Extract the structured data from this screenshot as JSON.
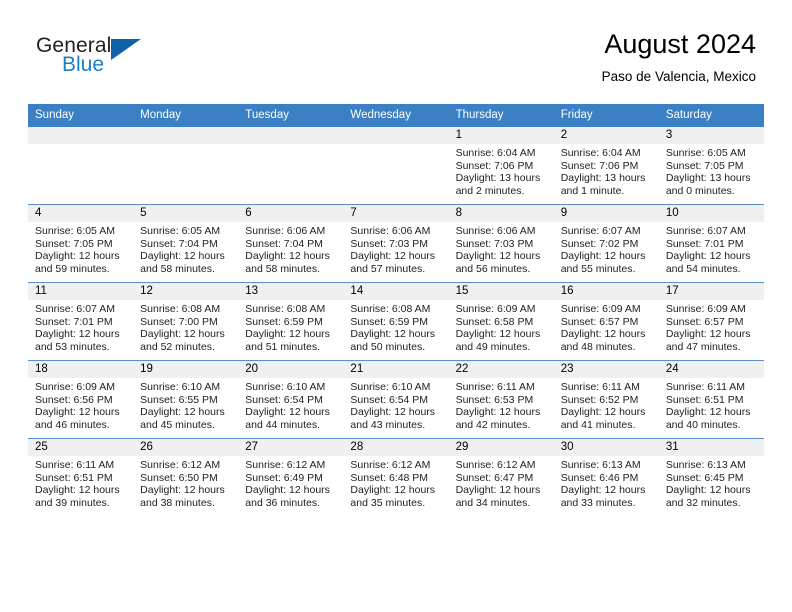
{
  "brand": {
    "word1": "General",
    "word2": "Blue",
    "triangle_color": "#0f62a8",
    "blue_text_color": "#1b7fc4"
  },
  "header": {
    "title": "August 2024",
    "subtitle": "Paso de Valencia, Mexico",
    "header_bg": "#3b7fc4",
    "daynum_bg": "#f0f0f0"
  },
  "weekday_headers": [
    "Sunday",
    "Monday",
    "Tuesday",
    "Wednesday",
    "Thursday",
    "Friday",
    "Saturday"
  ],
  "labels": {
    "sunrise": "Sunrise:",
    "sunset": "Sunset:",
    "daylight": "Daylight:"
  },
  "weeks": [
    [
      {
        "day": "",
        "empty": true
      },
      {
        "day": "",
        "empty": true
      },
      {
        "day": "",
        "empty": true
      },
      {
        "day": "",
        "empty": true
      },
      {
        "day": "1",
        "sunrise": "Sunrise: 6:04 AM",
        "sunset": "Sunset: 7:06 PM",
        "daylight_l1": "Daylight: 13 hours",
        "daylight_l2": "and 2 minutes."
      },
      {
        "day": "2",
        "sunrise": "Sunrise: 6:04 AM",
        "sunset": "Sunset: 7:06 PM",
        "daylight_l1": "Daylight: 13 hours",
        "daylight_l2": "and 1 minute."
      },
      {
        "day": "3",
        "sunrise": "Sunrise: 6:05 AM",
        "sunset": "Sunset: 7:05 PM",
        "daylight_l1": "Daylight: 13 hours",
        "daylight_l2": "and 0 minutes."
      }
    ],
    [
      {
        "day": "4",
        "sunrise": "Sunrise: 6:05 AM",
        "sunset": "Sunset: 7:05 PM",
        "daylight_l1": "Daylight: 12 hours",
        "daylight_l2": "and 59 minutes."
      },
      {
        "day": "5",
        "sunrise": "Sunrise: 6:05 AM",
        "sunset": "Sunset: 7:04 PM",
        "daylight_l1": "Daylight: 12 hours",
        "daylight_l2": "and 58 minutes."
      },
      {
        "day": "6",
        "sunrise": "Sunrise: 6:06 AM",
        "sunset": "Sunset: 7:04 PM",
        "daylight_l1": "Daylight: 12 hours",
        "daylight_l2": "and 58 minutes."
      },
      {
        "day": "7",
        "sunrise": "Sunrise: 6:06 AM",
        "sunset": "Sunset: 7:03 PM",
        "daylight_l1": "Daylight: 12 hours",
        "daylight_l2": "and 57 minutes."
      },
      {
        "day": "8",
        "sunrise": "Sunrise: 6:06 AM",
        "sunset": "Sunset: 7:03 PM",
        "daylight_l1": "Daylight: 12 hours",
        "daylight_l2": "and 56 minutes."
      },
      {
        "day": "9",
        "sunrise": "Sunrise: 6:07 AM",
        "sunset": "Sunset: 7:02 PM",
        "daylight_l1": "Daylight: 12 hours",
        "daylight_l2": "and 55 minutes."
      },
      {
        "day": "10",
        "sunrise": "Sunrise: 6:07 AM",
        "sunset": "Sunset: 7:01 PM",
        "daylight_l1": "Daylight: 12 hours",
        "daylight_l2": "and 54 minutes."
      }
    ],
    [
      {
        "day": "11",
        "sunrise": "Sunrise: 6:07 AM",
        "sunset": "Sunset: 7:01 PM",
        "daylight_l1": "Daylight: 12 hours",
        "daylight_l2": "and 53 minutes."
      },
      {
        "day": "12",
        "sunrise": "Sunrise: 6:08 AM",
        "sunset": "Sunset: 7:00 PM",
        "daylight_l1": "Daylight: 12 hours",
        "daylight_l2": "and 52 minutes."
      },
      {
        "day": "13",
        "sunrise": "Sunrise: 6:08 AM",
        "sunset": "Sunset: 6:59 PM",
        "daylight_l1": "Daylight: 12 hours",
        "daylight_l2": "and 51 minutes."
      },
      {
        "day": "14",
        "sunrise": "Sunrise: 6:08 AM",
        "sunset": "Sunset: 6:59 PM",
        "daylight_l1": "Daylight: 12 hours",
        "daylight_l2": "and 50 minutes."
      },
      {
        "day": "15",
        "sunrise": "Sunrise: 6:09 AM",
        "sunset": "Sunset: 6:58 PM",
        "daylight_l1": "Daylight: 12 hours",
        "daylight_l2": "and 49 minutes."
      },
      {
        "day": "16",
        "sunrise": "Sunrise: 6:09 AM",
        "sunset": "Sunset: 6:57 PM",
        "daylight_l1": "Daylight: 12 hours",
        "daylight_l2": "and 48 minutes."
      },
      {
        "day": "17",
        "sunrise": "Sunrise: 6:09 AM",
        "sunset": "Sunset: 6:57 PM",
        "daylight_l1": "Daylight: 12 hours",
        "daylight_l2": "and 47 minutes."
      }
    ],
    [
      {
        "day": "18",
        "sunrise": "Sunrise: 6:09 AM",
        "sunset": "Sunset: 6:56 PM",
        "daylight_l1": "Daylight: 12 hours",
        "daylight_l2": "and 46 minutes."
      },
      {
        "day": "19",
        "sunrise": "Sunrise: 6:10 AM",
        "sunset": "Sunset: 6:55 PM",
        "daylight_l1": "Daylight: 12 hours",
        "daylight_l2": "and 45 minutes."
      },
      {
        "day": "20",
        "sunrise": "Sunrise: 6:10 AM",
        "sunset": "Sunset: 6:54 PM",
        "daylight_l1": "Daylight: 12 hours",
        "daylight_l2": "and 44 minutes."
      },
      {
        "day": "21",
        "sunrise": "Sunrise: 6:10 AM",
        "sunset": "Sunset: 6:54 PM",
        "daylight_l1": "Daylight: 12 hours",
        "daylight_l2": "and 43 minutes."
      },
      {
        "day": "22",
        "sunrise": "Sunrise: 6:11 AM",
        "sunset": "Sunset: 6:53 PM",
        "daylight_l1": "Daylight: 12 hours",
        "daylight_l2": "and 42 minutes."
      },
      {
        "day": "23",
        "sunrise": "Sunrise: 6:11 AM",
        "sunset": "Sunset: 6:52 PM",
        "daylight_l1": "Daylight: 12 hours",
        "daylight_l2": "and 41 minutes."
      },
      {
        "day": "24",
        "sunrise": "Sunrise: 6:11 AM",
        "sunset": "Sunset: 6:51 PM",
        "daylight_l1": "Daylight: 12 hours",
        "daylight_l2": "and 40 minutes."
      }
    ],
    [
      {
        "day": "25",
        "sunrise": "Sunrise: 6:11 AM",
        "sunset": "Sunset: 6:51 PM",
        "daylight_l1": "Daylight: 12 hours",
        "daylight_l2": "and 39 minutes."
      },
      {
        "day": "26",
        "sunrise": "Sunrise: 6:12 AM",
        "sunset": "Sunset: 6:50 PM",
        "daylight_l1": "Daylight: 12 hours",
        "daylight_l2": "and 38 minutes."
      },
      {
        "day": "27",
        "sunrise": "Sunrise: 6:12 AM",
        "sunset": "Sunset: 6:49 PM",
        "daylight_l1": "Daylight: 12 hours",
        "daylight_l2": "and 36 minutes."
      },
      {
        "day": "28",
        "sunrise": "Sunrise: 6:12 AM",
        "sunset": "Sunset: 6:48 PM",
        "daylight_l1": "Daylight: 12 hours",
        "daylight_l2": "and 35 minutes."
      },
      {
        "day": "29",
        "sunrise": "Sunrise: 6:12 AM",
        "sunset": "Sunset: 6:47 PM",
        "daylight_l1": "Daylight: 12 hours",
        "daylight_l2": "and 34 minutes."
      },
      {
        "day": "30",
        "sunrise": "Sunrise: 6:13 AM",
        "sunset": "Sunset: 6:46 PM",
        "daylight_l1": "Daylight: 12 hours",
        "daylight_l2": "and 33 minutes."
      },
      {
        "day": "31",
        "sunrise": "Sunrise: 6:13 AM",
        "sunset": "Sunset: 6:45 PM",
        "daylight_l1": "Daylight: 12 hours",
        "daylight_l2": "and 32 minutes."
      }
    ]
  ]
}
